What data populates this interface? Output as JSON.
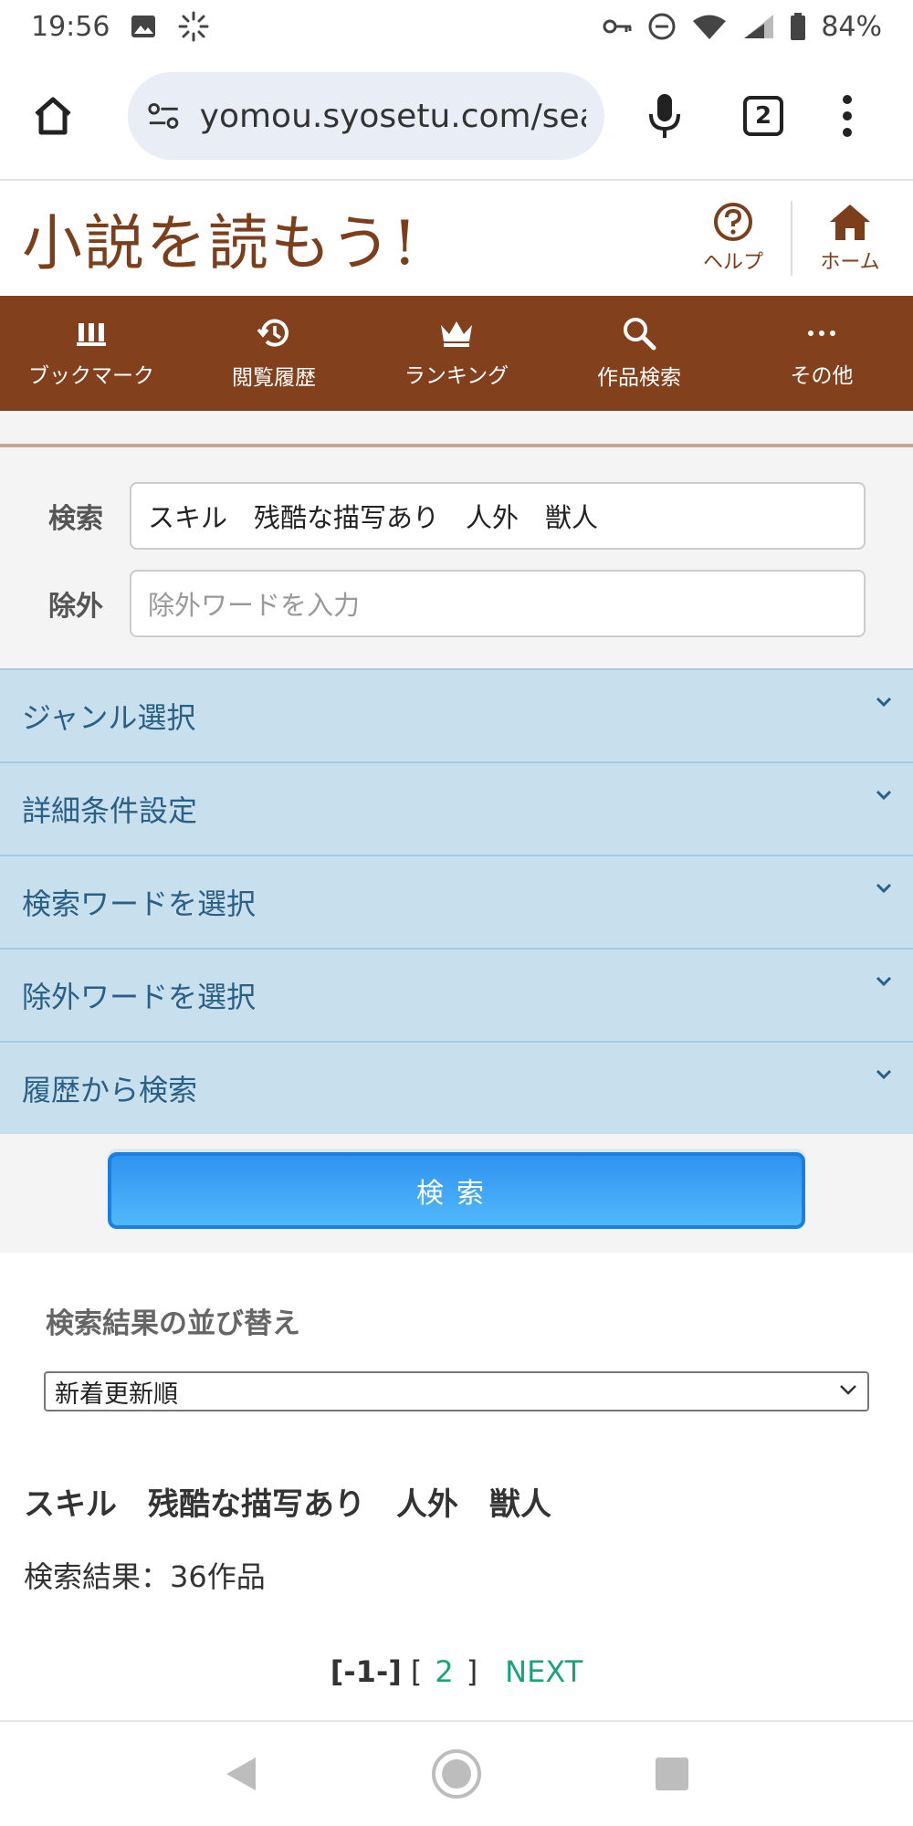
{
  "status_bar": {
    "time": "19:56",
    "battery": "84%",
    "icons": [
      "image-icon",
      "loading-icon",
      "key-icon",
      "dnd-icon",
      "wifi-icon",
      "signal-icon",
      "battery-icon"
    ]
  },
  "browser": {
    "url": "yomou.syosetu.com/sea",
    "tab_count": "2",
    "icons": [
      "home-icon",
      "site-settings-icon",
      "mic-icon",
      "tabs-icon",
      "menu-icon"
    ]
  },
  "site": {
    "logo": "小説を読もう!",
    "help_label": "ヘルプ",
    "home_label": "ホーム"
  },
  "nav": {
    "items": [
      {
        "label": "ブックマーク",
        "icon": "bookmark-icon"
      },
      {
        "label": "閲覧履歴",
        "icon": "history-icon"
      },
      {
        "label": "ランキング",
        "icon": "crown-icon"
      },
      {
        "label": "作品検索",
        "icon": "search-icon"
      },
      {
        "label": "その他",
        "icon": "more-icon"
      }
    ]
  },
  "search": {
    "search_label": "検索",
    "search_value": "スキル　残酷な描写あり　人外　獣人",
    "exclude_label": "除外",
    "exclude_placeholder": "除外ワードを入力"
  },
  "accordion": {
    "items": [
      {
        "label": "ジャンル選択"
      },
      {
        "label": "詳細条件設定"
      },
      {
        "label": "検索ワードを選択"
      },
      {
        "label": "除外ワードを選択"
      },
      {
        "label": "履歴から検索"
      }
    ]
  },
  "search_button": "検索",
  "sort": {
    "title": "検索結果の並び替え",
    "selected": "新着更新順"
  },
  "results": {
    "query": "スキル　残酷な描写あり　人外　獣人",
    "count_text": "検索結果：36作品"
  },
  "pager": {
    "current": "[-1-]",
    "open": "[",
    "page2": "2",
    "close": "]",
    "next": "NEXT"
  },
  "colors": {
    "brand_brown": "#82401c",
    "accordion_bg": "#c8dfed",
    "accordion_text": "#2a5f86",
    "button_blue": "#2f93f0",
    "link_green": "#1aa27a"
  }
}
